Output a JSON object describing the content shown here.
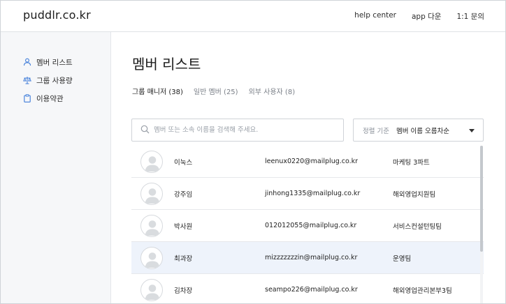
{
  "app": {
    "logo": "puddlr.co.kr"
  },
  "header": {
    "nav": [
      "help center",
      "app 다운",
      "1:1 문의"
    ]
  },
  "sidebar": {
    "items": [
      {
        "label": "멤버 리스트",
        "icon": "person-icon"
      },
      {
        "label": "그룹 사용량",
        "icon": "scale-icon"
      },
      {
        "label": "이용약관",
        "icon": "clipboard-icon"
      }
    ]
  },
  "main": {
    "title": "멤버 리스트",
    "tabs": [
      {
        "label": "그룹 매니저 (38)",
        "active": true
      },
      {
        "label": "일반 멤버 (25)",
        "active": false
      },
      {
        "label": "외부 사용자 (8)",
        "active": false
      }
    ],
    "search": {
      "placeholder": "멤버 또는 소속 이름을 검색해 주세요.",
      "value": ""
    },
    "sort": {
      "label": "정렬 기준",
      "value": "멤버 이름 오름차순"
    },
    "members": [
      {
        "name": "이눅스",
        "email": "leenux0220@mailplug.co.kr",
        "dept": "마케팅 3파트",
        "highlighted": false
      },
      {
        "name": "강주임",
        "email": "jinhong1335@mailplug.co.kr",
        "dept": "해외영업지원팀",
        "highlighted": false
      },
      {
        "name": "박사원",
        "email": "012012055@mailplug.co.kr",
        "dept": "서비스컨설턴팅팀",
        "highlighted": false
      },
      {
        "name": "최과장",
        "email": "mizzzzzzzin@mailplug.co.kr",
        "dept": "운영팀",
        "highlighted": true
      },
      {
        "name": "김차장",
        "email": "seampo226@mailplug.co.kr",
        "dept": "해외영업관리본부3팀",
        "highlighted": false
      }
    ]
  },
  "colors": {
    "accent_underline": "#ffe14d",
    "highlight_row": "#eef3fb",
    "sidebar_bg": "#f6f7f9",
    "icon_blue": "#3d7bd9"
  }
}
